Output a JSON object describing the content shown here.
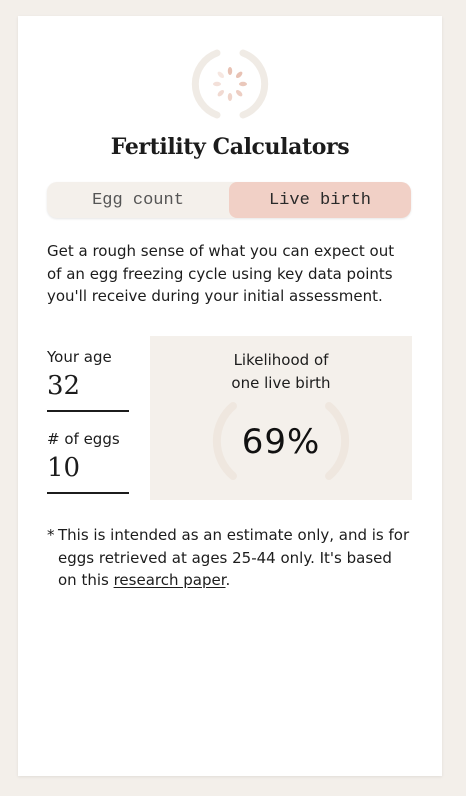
{
  "header": {
    "title": "Fertility Calculators"
  },
  "tabs": [
    {
      "label": "Egg count",
      "active": false
    },
    {
      "label": "Live birth",
      "active": true
    }
  ],
  "intro": "Get a rough sense of what you can expect out of an egg freezing cycle using key data points you'll receive during your initial assessment.",
  "inputs": {
    "age": {
      "label": "Your age",
      "value": "32"
    },
    "eggs": {
      "label": "# of eggs",
      "value": "10"
    }
  },
  "result": {
    "label_line1": "Likelihood of",
    "label_line2": "one live birth",
    "value": "69%"
  },
  "note": {
    "star": "*",
    "text_before": "This is intended as an estimate only, and is for eggs retrieved at ages 25-44 only. It's based on this ",
    "link_text": "research paper",
    "text_after": "."
  },
  "icons": {
    "logo": "loading-spinner-icon",
    "result_ring": "progress-ring-icon"
  },
  "colors": {
    "background": "#f3efea",
    "card": "#ffffff",
    "accent_active_tab": "#f1d0c6",
    "panel": "#f4f0eb",
    "ring": "#efe7df",
    "spinner_dot": "#e8c2b4"
  }
}
